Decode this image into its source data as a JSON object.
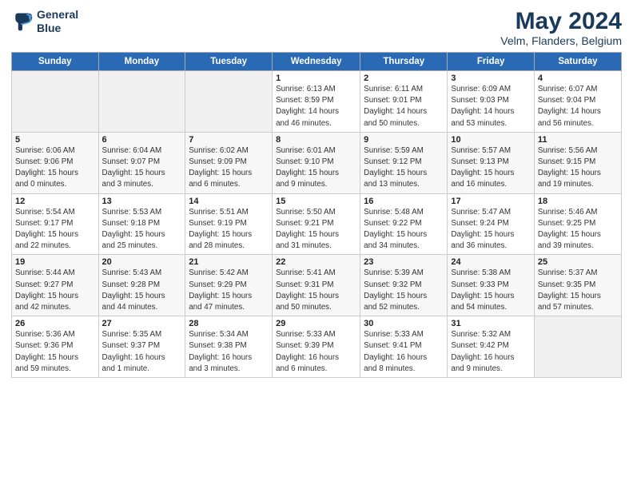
{
  "header": {
    "logo_line1": "General",
    "logo_line2": "Blue",
    "main_title": "May 2024",
    "subtitle": "Velm, Flanders, Belgium"
  },
  "weekdays": [
    "Sunday",
    "Monday",
    "Tuesday",
    "Wednesday",
    "Thursday",
    "Friday",
    "Saturday"
  ],
  "weeks": [
    [
      {
        "num": "",
        "info": ""
      },
      {
        "num": "",
        "info": ""
      },
      {
        "num": "",
        "info": ""
      },
      {
        "num": "1",
        "info": "Sunrise: 6:13 AM\nSunset: 8:59 PM\nDaylight: 14 hours\nand 46 minutes."
      },
      {
        "num": "2",
        "info": "Sunrise: 6:11 AM\nSunset: 9:01 PM\nDaylight: 14 hours\nand 50 minutes."
      },
      {
        "num": "3",
        "info": "Sunrise: 6:09 AM\nSunset: 9:03 PM\nDaylight: 14 hours\nand 53 minutes."
      },
      {
        "num": "4",
        "info": "Sunrise: 6:07 AM\nSunset: 9:04 PM\nDaylight: 14 hours\nand 56 minutes."
      }
    ],
    [
      {
        "num": "5",
        "info": "Sunrise: 6:06 AM\nSunset: 9:06 PM\nDaylight: 15 hours\nand 0 minutes."
      },
      {
        "num": "6",
        "info": "Sunrise: 6:04 AM\nSunset: 9:07 PM\nDaylight: 15 hours\nand 3 minutes."
      },
      {
        "num": "7",
        "info": "Sunrise: 6:02 AM\nSunset: 9:09 PM\nDaylight: 15 hours\nand 6 minutes."
      },
      {
        "num": "8",
        "info": "Sunrise: 6:01 AM\nSunset: 9:10 PM\nDaylight: 15 hours\nand 9 minutes."
      },
      {
        "num": "9",
        "info": "Sunrise: 5:59 AM\nSunset: 9:12 PM\nDaylight: 15 hours\nand 13 minutes."
      },
      {
        "num": "10",
        "info": "Sunrise: 5:57 AM\nSunset: 9:13 PM\nDaylight: 15 hours\nand 16 minutes."
      },
      {
        "num": "11",
        "info": "Sunrise: 5:56 AM\nSunset: 9:15 PM\nDaylight: 15 hours\nand 19 minutes."
      }
    ],
    [
      {
        "num": "12",
        "info": "Sunrise: 5:54 AM\nSunset: 9:17 PM\nDaylight: 15 hours\nand 22 minutes."
      },
      {
        "num": "13",
        "info": "Sunrise: 5:53 AM\nSunset: 9:18 PM\nDaylight: 15 hours\nand 25 minutes."
      },
      {
        "num": "14",
        "info": "Sunrise: 5:51 AM\nSunset: 9:19 PM\nDaylight: 15 hours\nand 28 minutes."
      },
      {
        "num": "15",
        "info": "Sunrise: 5:50 AM\nSunset: 9:21 PM\nDaylight: 15 hours\nand 31 minutes."
      },
      {
        "num": "16",
        "info": "Sunrise: 5:48 AM\nSunset: 9:22 PM\nDaylight: 15 hours\nand 34 minutes."
      },
      {
        "num": "17",
        "info": "Sunrise: 5:47 AM\nSunset: 9:24 PM\nDaylight: 15 hours\nand 36 minutes."
      },
      {
        "num": "18",
        "info": "Sunrise: 5:46 AM\nSunset: 9:25 PM\nDaylight: 15 hours\nand 39 minutes."
      }
    ],
    [
      {
        "num": "19",
        "info": "Sunrise: 5:44 AM\nSunset: 9:27 PM\nDaylight: 15 hours\nand 42 minutes."
      },
      {
        "num": "20",
        "info": "Sunrise: 5:43 AM\nSunset: 9:28 PM\nDaylight: 15 hours\nand 44 minutes."
      },
      {
        "num": "21",
        "info": "Sunrise: 5:42 AM\nSunset: 9:29 PM\nDaylight: 15 hours\nand 47 minutes."
      },
      {
        "num": "22",
        "info": "Sunrise: 5:41 AM\nSunset: 9:31 PM\nDaylight: 15 hours\nand 50 minutes."
      },
      {
        "num": "23",
        "info": "Sunrise: 5:39 AM\nSunset: 9:32 PM\nDaylight: 15 hours\nand 52 minutes."
      },
      {
        "num": "24",
        "info": "Sunrise: 5:38 AM\nSunset: 9:33 PM\nDaylight: 15 hours\nand 54 minutes."
      },
      {
        "num": "25",
        "info": "Sunrise: 5:37 AM\nSunset: 9:35 PM\nDaylight: 15 hours\nand 57 minutes."
      }
    ],
    [
      {
        "num": "26",
        "info": "Sunrise: 5:36 AM\nSunset: 9:36 PM\nDaylight: 15 hours\nand 59 minutes."
      },
      {
        "num": "27",
        "info": "Sunrise: 5:35 AM\nSunset: 9:37 PM\nDaylight: 16 hours\nand 1 minute."
      },
      {
        "num": "28",
        "info": "Sunrise: 5:34 AM\nSunset: 9:38 PM\nDaylight: 16 hours\nand 3 minutes."
      },
      {
        "num": "29",
        "info": "Sunrise: 5:33 AM\nSunset: 9:39 PM\nDaylight: 16 hours\nand 6 minutes."
      },
      {
        "num": "30",
        "info": "Sunrise: 5:33 AM\nSunset: 9:41 PM\nDaylight: 16 hours\nand 8 minutes."
      },
      {
        "num": "31",
        "info": "Sunrise: 5:32 AM\nSunset: 9:42 PM\nDaylight: 16 hours\nand 9 minutes."
      },
      {
        "num": "",
        "info": ""
      }
    ]
  ]
}
